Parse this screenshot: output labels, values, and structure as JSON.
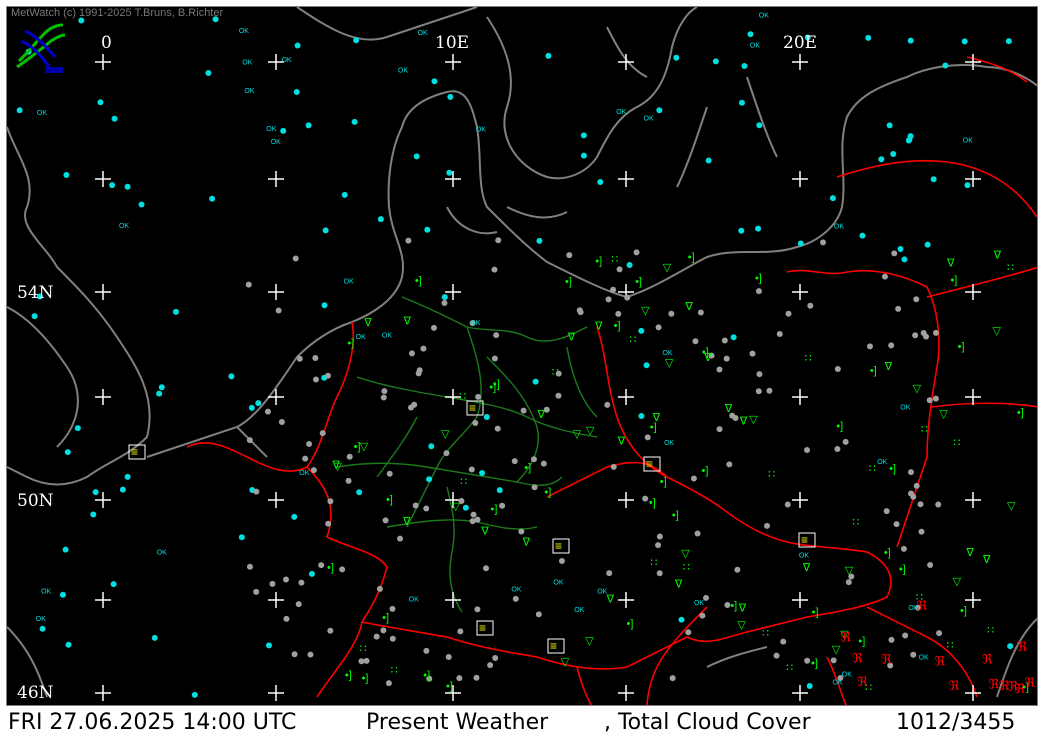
{
  "header": {
    "credit": "MetWatch  (c) 1991-2025 T.Bruns, B.Richter"
  },
  "grid_labels": {
    "lon": [
      "0",
      "10E",
      "20E"
    ],
    "lat": [
      "54N",
      "50N",
      "46N"
    ]
  },
  "footer": {
    "datetime": "FRI 27.06.2025 14:00 UTC",
    "product": "Present Weather",
    "overlay": ", Total Cloud Cover",
    "count": "1012/3455"
  },
  "stations": {
    "ok_label": "OK"
  },
  "colors": {
    "background": "#000000",
    "coastline": "#808080",
    "border": "#ff0000",
    "state_border": "#006400",
    "grid": "#ffffff",
    "station_clear": "#00e0e0",
    "station_cloudy": "#a0a0a0",
    "weather_green": "#00ff00",
    "weather_red": "#ff0000",
    "weather_yellow": "#ffff00"
  }
}
